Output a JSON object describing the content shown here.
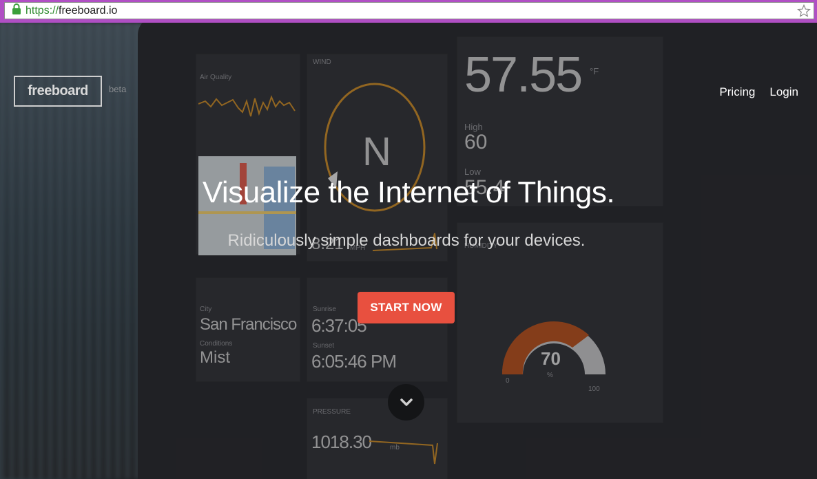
{
  "browser": {
    "url_scheme": "https://",
    "url_host": "freeboard.io",
    "lock_icon": "lock-icon",
    "bookmark_icon": "star-icon"
  },
  "header": {
    "logo": "freeboard",
    "badge": "beta",
    "nav": [
      "Pricing",
      "Login"
    ]
  },
  "hero": {
    "title": "Visualize the Internet of Things.",
    "subtitle": "Ridiculously simple dashboards for your devices.",
    "cta_label": "START NOW",
    "scroll_icon": "chevron-down-icon"
  },
  "background_dashboard": {
    "temperature": "57.55",
    "temp_unit": "°F",
    "high_label": "High",
    "high_value": "60",
    "low_label": "Low",
    "low_value": "55.4",
    "wind_heading": "N",
    "wind_speed": "8.21",
    "wind_unit": "MPH",
    "city_label": "City",
    "city": "San Francisco",
    "conditions_label": "Conditions",
    "conditions": "Mist",
    "sunrise_label": "Sunrise",
    "sunrise": "6:37:05",
    "sunset_label": "Sunset",
    "sunset": "6:05:46 PM",
    "pressure_label": "PRESSURE",
    "pressure": "1018.30",
    "pressure_unit": "mb",
    "humidity_label": "HUMIDITY",
    "humidity": "70",
    "humidity_unit": "%",
    "gauge_min": "0",
    "gauge_max": "100",
    "wind_label": "WIND",
    "air_quality_label": "Air Quality"
  },
  "colors": {
    "cta": "#e8503f",
    "gauge": "#b5501c",
    "compass": "#c98a26",
    "chrome": "#b04fc4"
  }
}
